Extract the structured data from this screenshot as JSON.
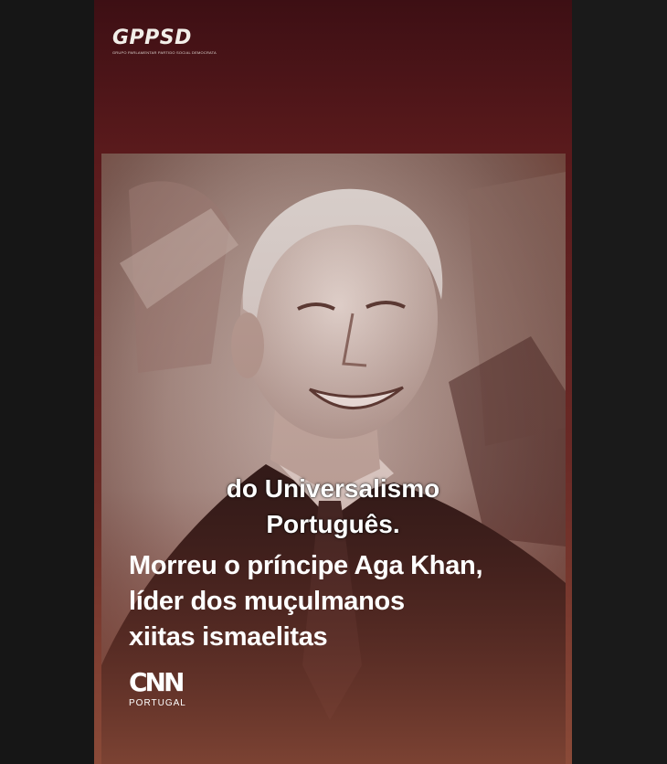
{
  "logo": {
    "name": "GPPSD",
    "subtitle": "GRUPO PARLAMENTAR PARTIDO SOCIAL DEMOCRATA"
  },
  "caption": {
    "line1": "do Universalismo",
    "line2": "Português."
  },
  "headline": {
    "line1": "Morreu o príncipe Aga Khan,",
    "line2": "líder dos muçulmanos",
    "line3": "xiitas ismaelitas"
  },
  "brand": {
    "mark": "CNN",
    "sub": "PORTUGAL"
  },
  "colors": {
    "frame_top": "#3d0f14",
    "frame_bottom": "#8a4a38",
    "side_bars": "#161616",
    "text": "#ffffff"
  }
}
